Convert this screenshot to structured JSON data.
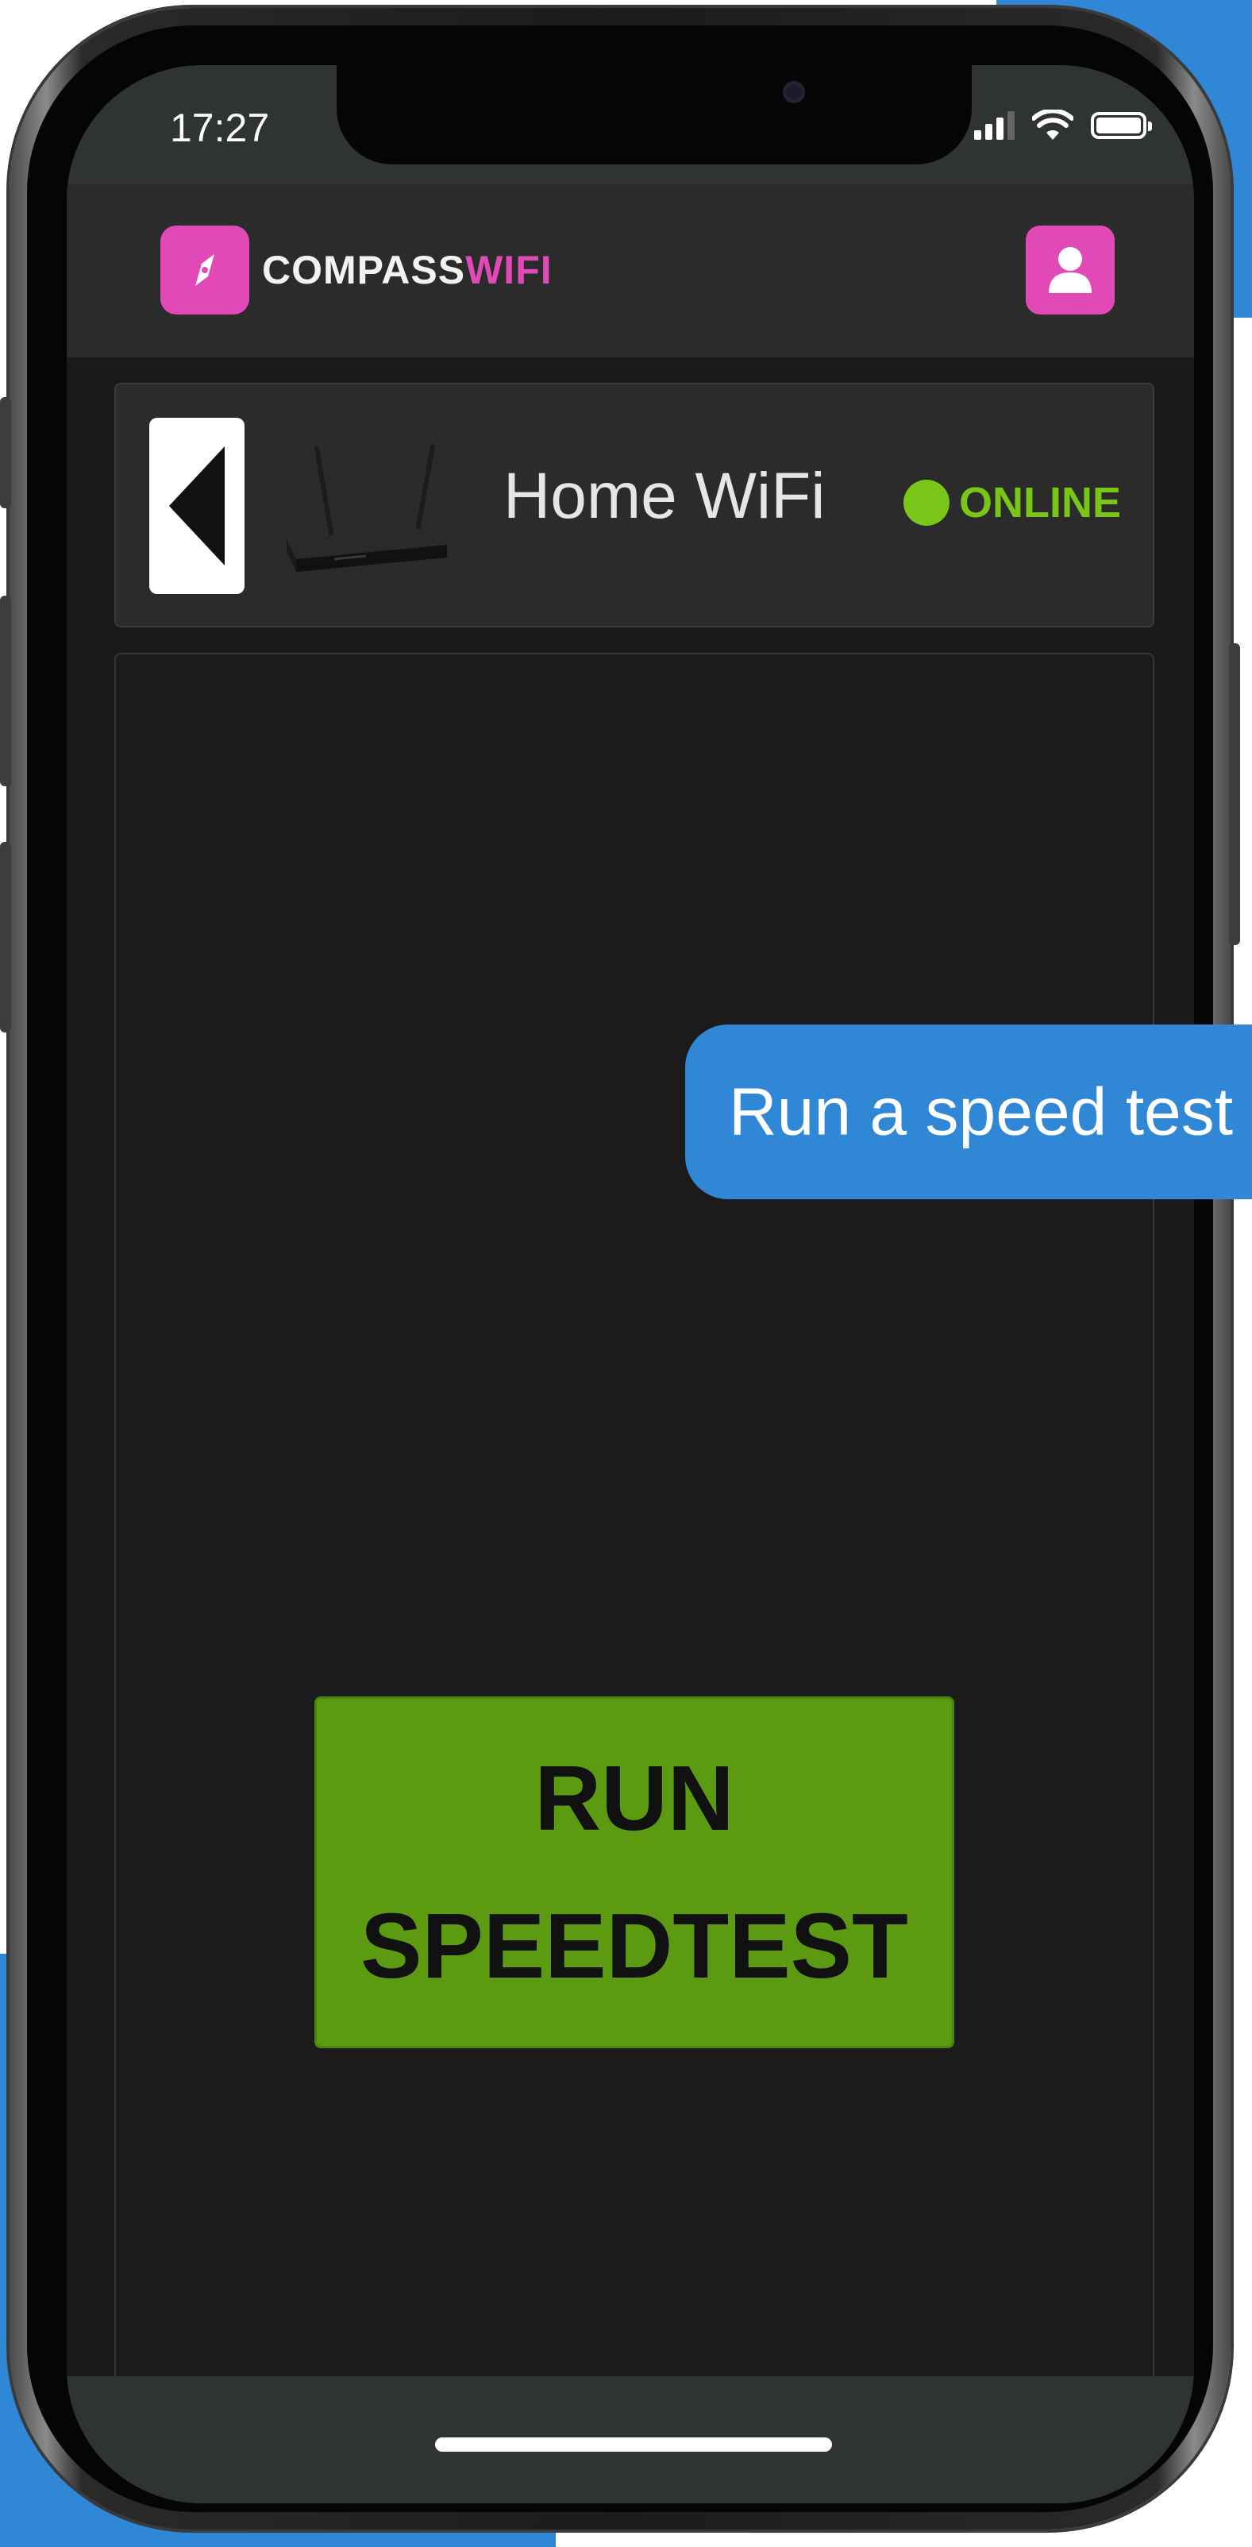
{
  "status_bar": {
    "time": "17:27"
  },
  "header": {
    "logo_text_part1": "COMPASS",
    "logo_text_part2": "WIFI",
    "logo_icon": "compass-icon",
    "user_icon": "user-icon"
  },
  "device": {
    "name": "Home WiFi",
    "status": "ONLINE",
    "status_color": "#7ac618"
  },
  "speedtest": {
    "button_line1": "RUN",
    "button_line2": "SPEEDTEST",
    "button_color": "#5c9a12"
  },
  "callout": {
    "text": "Run a speed test"
  },
  "colors": {
    "brand_pink": "#e14ab6",
    "accent_blue": "#2f87d6"
  }
}
